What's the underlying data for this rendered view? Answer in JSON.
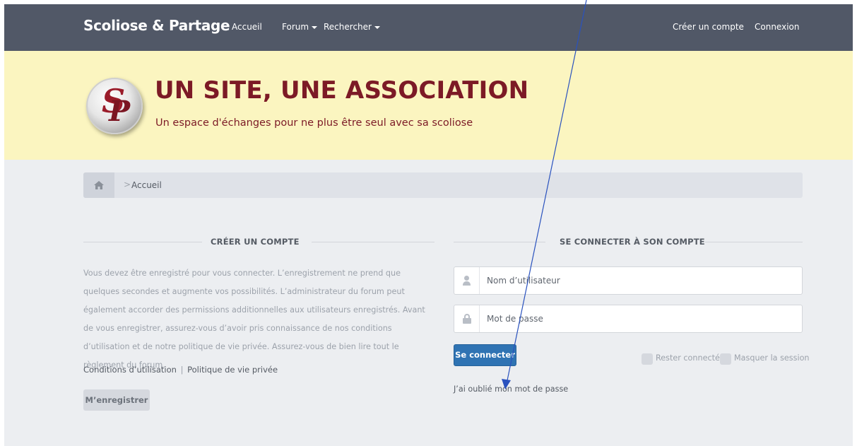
{
  "navbar": {
    "brand": "Scoliose & Partage",
    "links": {
      "home": "Accueil",
      "forum": "Forum",
      "search": "Rechercher"
    },
    "create_account": "Créer un compte",
    "login": "Connexion"
  },
  "banner": {
    "title": "UN SITE, UNE ASSOCIATION",
    "subtitle": "Un espace d'échanges pour ne plus être seul avec sa scoliose"
  },
  "breadcrumb": {
    "current": "Accueil"
  },
  "register_section": {
    "heading": "CRÉER UN COMPTE",
    "intro": "Vous devez être enregistré pour vous connecter. L’enregistrement ne prend que quelques secondes et augmente vos possibilités. L’administrateur du forum peut également accorder des permissions additionnelles aux utilisateurs enregistrés. Avant de vous enregistrer, assurez-vous d’avoir pris connaissance de nos conditions d’utilisation et de notre politique de vie privée. Assurez-vous de bien lire tout le règlement du forum.",
    "terms_link": "Conditions d’utilisation",
    "separator": "|",
    "privacy_link": "Politique de vie privée",
    "register_button": "M’enregistrer"
  },
  "login_section": {
    "heading": "SE CONNECTER À SON COMPTE",
    "username_placeholder": "Nom d’utilisateur",
    "password_placeholder": "Mot de passe",
    "submit": "Se connecter",
    "remember_me": "Rester connecté",
    "hide_session": "Masquer la session",
    "forgot_password": "J’ai oublié mon mot de passe"
  },
  "colors": {
    "navbar_bg": "#515867",
    "banner_bg": "#fbf5c0",
    "banner_text": "#7c1a26",
    "page_bg": "#eceef1",
    "primary_button": "#2f73b3",
    "annotation_arrow": "#2a52be"
  },
  "icons": [
    "home-icon",
    "user-icon",
    "lock-icon",
    "caret-down-icon"
  ]
}
